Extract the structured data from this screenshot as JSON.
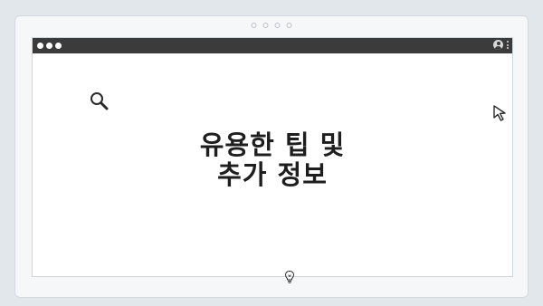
{
  "title": {
    "line1": "유용한 팁 및",
    "line2": "추가 정보"
  },
  "icons": {
    "window_controls": "traffic-light-dots",
    "user": "user-circle-icon",
    "menu": "kebab-menu-icon",
    "search": "magnifier-icon",
    "cursor": "mouse-pointer-icon",
    "bulb": "lightbulb-icon"
  },
  "colors": {
    "titlebar": "#3b3b3b",
    "background": "#e2e7ec",
    "text": "#1e1e1e"
  }
}
